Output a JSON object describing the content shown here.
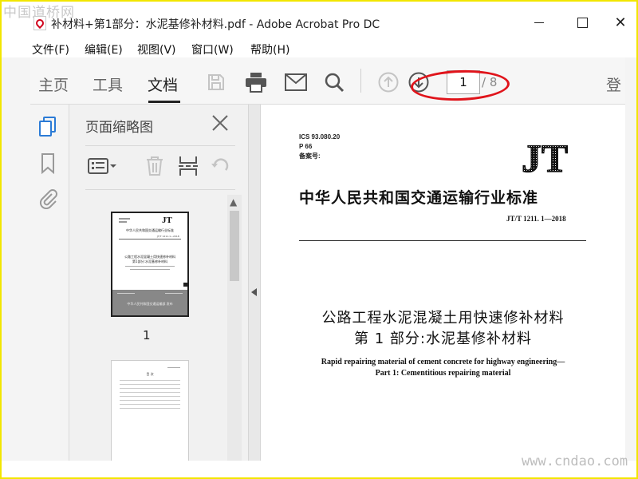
{
  "window": {
    "title": "补材料+第1部分：水泥基修补材料.pdf - Adobe Acrobat Pro DC",
    "minimize_icon": "minimize-icon",
    "maximize_icon": "maximize-icon",
    "close_icon": "close-icon"
  },
  "watermarks": {
    "top": "中国道桥网",
    "bottom": "www.cndao.com"
  },
  "menu": [
    "文件(F)",
    "编辑(E)",
    "视图(V)",
    "窗口(W)",
    "帮助(H)"
  ],
  "toolbar": {
    "tabs": [
      "主页",
      "工具",
      "文档"
    ],
    "active_tab": "文档",
    "icons": [
      "save-icon",
      "print-icon",
      "email-icon",
      "search-icon",
      "previous-page-icon",
      "next-page-icon"
    ],
    "page_current": "1",
    "page_total": "/ 8",
    "login": "登"
  },
  "sidebar": {
    "rail_icons": [
      "page-thumbnails-icon",
      "bookmark-icon",
      "attachment-icon"
    ],
    "panel_title": "页面缩略图",
    "panel_tools": [
      "thumbnail-options-icon",
      "delete-page-icon",
      "extract-page-icon",
      "undo-icon"
    ],
    "thumbnails": [
      {
        "label": "1",
        "logo": "JT",
        "org": "中华人民共和国交通运输行业标准",
        "code": "JT/T 1211.1—2018",
        "title_cn": "公路工程水泥混凝土用快速修补材料",
        "subtitle_cn": "第1部分:水泥基修补材料",
        "publisher": "中华人民共和国交通运输部 发布"
      },
      {
        "label": "",
        "heading": "目 次"
      }
    ]
  },
  "document": {
    "ics": "ICS 93.080.20",
    "p": "P 66",
    "record": "备案号:",
    "logo": "JT",
    "standard_org": "中华人民共和国交通运输行业标准",
    "code": "JT/T 1211. 1—2018",
    "title_line1": "公路工程水泥混凝土用快速修补材料",
    "title_line2": "第 1 部分:水泥基修补材料",
    "english_line1": "Rapid repairing material of cement concrete for highway engineering—",
    "english_line2": "Part 1: Cementitious repairing material"
  },
  "colors": {
    "accent_blue": "#2b7bd6",
    "annotation_red": "#e0141b",
    "frame_yellow": "#f2e600"
  }
}
